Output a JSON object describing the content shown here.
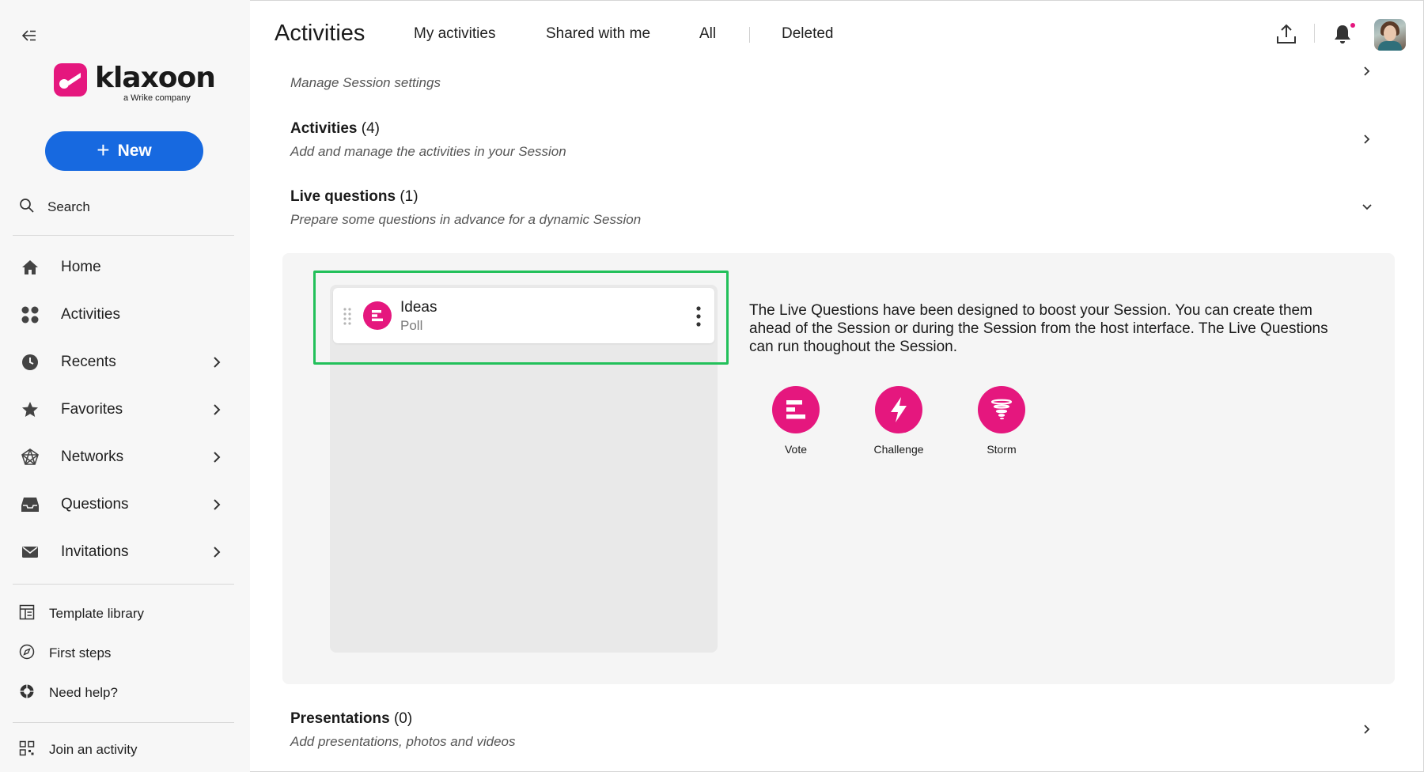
{
  "sidebar": {
    "logo": {
      "word": "klaxoon",
      "sub": "a Wrike company"
    },
    "new_label": "New",
    "search_label": "Search",
    "nav": [
      {
        "label": "Home",
        "icon": "home-icon",
        "has_chevron": false
      },
      {
        "label": "Activities",
        "icon": "grid-dots-icon",
        "has_chevron": false
      },
      {
        "label": "Recents",
        "icon": "clock-icon",
        "has_chevron": true
      },
      {
        "label": "Favorites",
        "icon": "star-icon",
        "has_chevron": true
      },
      {
        "label": "Networks",
        "icon": "network-icon",
        "has_chevron": true
      },
      {
        "label": "Questions",
        "icon": "inbox-icon",
        "has_chevron": true
      },
      {
        "label": "Invitations",
        "icon": "envelope-icon",
        "has_chevron": true
      }
    ],
    "footer": [
      {
        "label": "Template library",
        "icon": "template-icon"
      },
      {
        "label": "First steps",
        "icon": "compass-icon"
      },
      {
        "label": "Need help?",
        "icon": "help-icon"
      }
    ],
    "join_label": "Join an activity"
  },
  "header": {
    "title": "Activities",
    "tabs": [
      "My activities",
      "Shared with me",
      "All",
      "Deleted"
    ]
  },
  "sections": {
    "settings": {
      "subtitle": "Manage Session settings"
    },
    "activities": {
      "title": "Activities",
      "count": "(4)",
      "subtitle": "Add and manage the activities in your Session"
    },
    "live_questions": {
      "title": "Live questions",
      "count": "(1)",
      "subtitle": "Prepare some questions in advance for a dynamic Session"
    },
    "presentations": {
      "title": "Presentations",
      "count": "(0)",
      "subtitle": "Add presentations, photos and videos"
    }
  },
  "live_questions_panel": {
    "question": {
      "title": "Ideas",
      "type": "Poll"
    },
    "description": "The Live Questions have been designed to boost your Session. You can create them ahead of the Session or during the Session from the host interface. The Live Questions can run thoughout the Session.",
    "types": [
      {
        "label": "Vote",
        "icon": "vote-icon"
      },
      {
        "label": "Challenge",
        "icon": "lightning-icon"
      },
      {
        "label": "Storm",
        "icon": "tornado-icon"
      }
    ]
  },
  "colors": {
    "brand": "#e5177e",
    "primary_button": "#1769e0",
    "highlight": "#22c05a"
  }
}
